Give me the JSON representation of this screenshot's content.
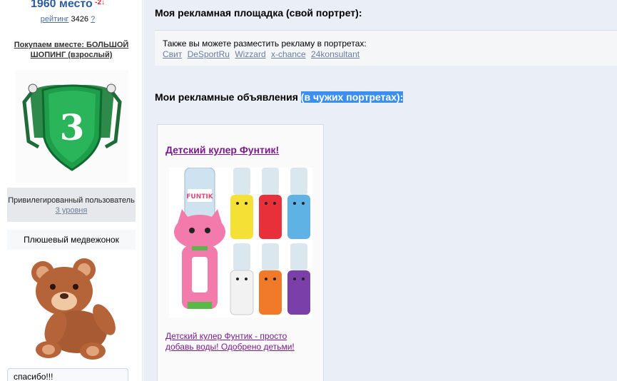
{
  "sidebar": {
    "rank": {
      "place": "1960 место",
      "delta": "-2↓",
      "rating_label": "рейтинг",
      "rating_value": "3426",
      "help": "?"
    },
    "group_link": "Покупаем вместе: БОЛЬШОЙ ШОПИНГ (взрослый)",
    "badge_number": "3",
    "privileged": {
      "text": "Привилегированный пользователь",
      "level": "3 уровня"
    },
    "gift_title": "Плюшевый медвежонок",
    "thanks": "спасибо!!!"
  },
  "main": {
    "my_platform_title": "Моя рекламная площадка (свой портрет):",
    "banner": {
      "text": "Также вы можете разместить рекламу в портретах:",
      "links": [
        "Свит",
        "DeSportRu",
        "Wizzard",
        "x-chance",
        "24konsultant"
      ]
    },
    "my_ads_title": "Мои рекламные объявления",
    "my_ads_title_sel": "(в чужих портретах):",
    "ad": {
      "title": "Детский кулер Фунтик!",
      "description": "Детский кулер Фунтик - просто добавь воды! Одобрено детьми!"
    }
  },
  "colors": {
    "accent": "#2b5aa0",
    "delta": "#e0201c",
    "visited": "#7a1a8c",
    "selection": "#3b8ff0",
    "badge_green": "#1e9e4a"
  }
}
